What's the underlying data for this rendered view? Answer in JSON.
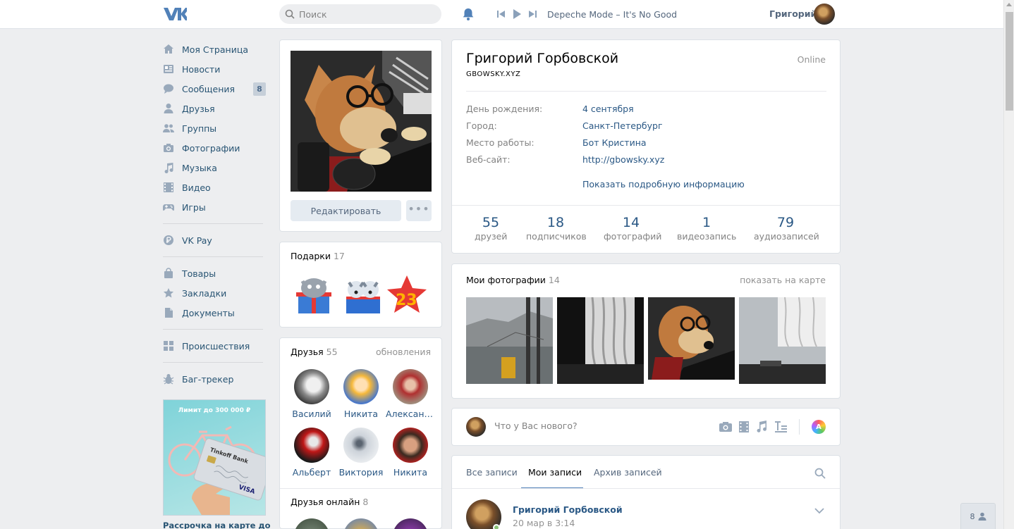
{
  "header": {
    "logo": "VK",
    "search_placeholder": "Поиск",
    "track": "Depeche Mode – It's No Good",
    "user_name": "Григорий"
  },
  "left_menu": {
    "items": [
      {
        "label": "Моя Страница",
        "icon": "home-icon"
      },
      {
        "label": "Новости",
        "icon": "news-icon"
      },
      {
        "label": "Сообщения",
        "icon": "messages-icon",
        "badge": "8"
      },
      {
        "label": "Друзья",
        "icon": "friends-icon"
      },
      {
        "label": "Группы",
        "icon": "groups-icon"
      },
      {
        "label": "Фотографии",
        "icon": "camera-icon"
      },
      {
        "label": "Музыка",
        "icon": "music-note-icon"
      },
      {
        "label": "Видео",
        "icon": "film-icon"
      },
      {
        "label": "Игры",
        "icon": "gamepad-icon"
      }
    ],
    "pay": {
      "label": "VK Pay",
      "icon": "ruble-coin-icon"
    },
    "items2": [
      {
        "label": "Товары",
        "icon": "bag-icon"
      },
      {
        "label": "Закладки",
        "icon": "star-icon"
      },
      {
        "label": "Документы",
        "icon": "document-icon"
      }
    ],
    "incidents": {
      "label": "Происшествия",
      "icon": "tiles-icon"
    },
    "bugtracker": {
      "label": "Баг-трекер",
      "icon": "bug-icon"
    },
    "ad": {
      "top_text": "Лимит до 300 000 ₽",
      "card_brand": "Tinkoff Bank",
      "card_network": "VISA",
      "caption": "Рассрочка на карте до"
    }
  },
  "avatar_block": {
    "edit_label": "Редактировать",
    "more_label": "•••"
  },
  "gifts": {
    "title": "Подарки",
    "count": "17",
    "number_gift": "23"
  },
  "friends": {
    "title": "Друзья",
    "count": "55",
    "updates_label": "обновления",
    "list": [
      {
        "name": "Василий"
      },
      {
        "name": "Никита"
      },
      {
        "name": "Александ..."
      },
      {
        "name": "Альберт"
      },
      {
        "name": "Виктория"
      },
      {
        "name": "Никита"
      }
    ],
    "online_title": "Друзья онлайн",
    "online_count": "8"
  },
  "profile": {
    "name": "Григорий Горбовской",
    "status": "GBOWSKY.XYZ",
    "online": "Online",
    "info": [
      {
        "label": "День рождения:",
        "value": "4 сентября"
      },
      {
        "label": "Город:",
        "value": "Санкт-Петербург"
      },
      {
        "label": "Место работы:",
        "value": "Бот Кристина"
      },
      {
        "label": "Веб-сайт:",
        "value": "http://gbowsky.xyz"
      }
    ],
    "more_info": "Показать подробную информацию",
    "counters": [
      {
        "num": "55",
        "label": "друзей"
      },
      {
        "num": "18",
        "label": "подписчиков"
      },
      {
        "num": "14",
        "label": "фотографий"
      },
      {
        "num": "1",
        "label": "видеозапись"
      },
      {
        "num": "79",
        "label": "аудиозаписей"
      }
    ]
  },
  "photos": {
    "title": "Мои фотографии",
    "count": "14",
    "map_label": "показать на карте"
  },
  "new_post": {
    "placeholder": "Что у Вас нового?"
  },
  "wall": {
    "tabs": [
      "Все записи",
      "Мои записи",
      "Архив записей"
    ],
    "active_tab": "Мои записи",
    "post": {
      "author": "Григорий Горбовской",
      "date": "20 мар в 3:14"
    }
  },
  "bottom_counter": "8",
  "colors": {
    "link": "#2a5885",
    "accent": "#5181b8",
    "background": "#edeef0",
    "badge": "#c6cfd9",
    "online_dot": "#8ac176"
  }
}
